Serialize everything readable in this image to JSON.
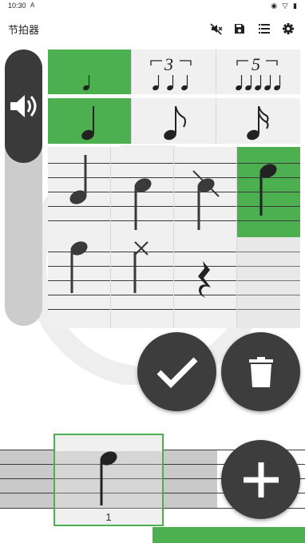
{
  "status_bar": {
    "time": "10:30",
    "notification": "A",
    "system_icons": "◉ ▽ ▮"
  },
  "app_bar": {
    "title": "节拍器",
    "actions": [
      "mute-icon",
      "save-icon",
      "list-icon",
      "gear-icon"
    ]
  },
  "volume": {
    "icon": "speaker-icon",
    "level": 0.37
  },
  "subdivision_row": {
    "items": [
      "single",
      "3",
      "5"
    ],
    "selected": 0
  },
  "note_value_row": {
    "items": [
      "quarter",
      "eighth",
      "sixteenth"
    ],
    "selected": 0
  },
  "sound_grid": {
    "selected": 3
  },
  "beat": {
    "number": "1"
  },
  "fab": {
    "confirm": "check-icon",
    "delete": "trash-icon",
    "add": "plus-icon"
  },
  "colors": {
    "accent": "#4caf50",
    "dark": "#3d3d3d",
    "panel": "#f0f0f0"
  }
}
